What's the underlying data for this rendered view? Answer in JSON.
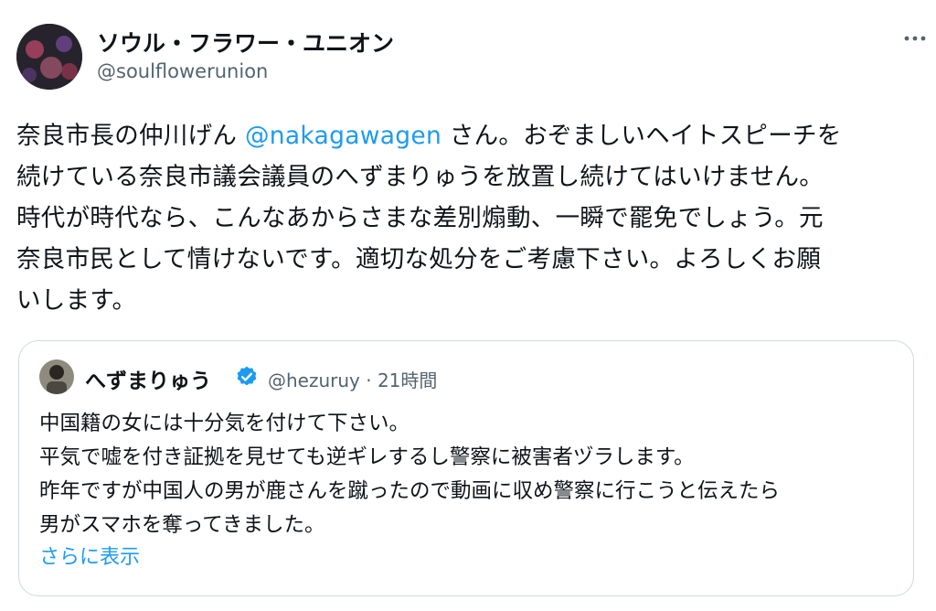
{
  "tweet": {
    "author": {
      "name": "ソウル・フラワー・ユニオン",
      "handle": "@soulflowerunion",
      "avatar_icon": "band-photo-avatar"
    },
    "more_icon": "more-options-icon",
    "body": {
      "before_mention": "奈良市長の仲川げん ",
      "mention": "@nakagawagen",
      "after_mention": " さん。おぞましいヘイトスピーチを\n続けている奈良市議会議員のへずまりゅうを放置し続けてはいけません。\n時代が時代なら、こんなあからさまな差別煽動、一瞬で罷免でしょう。元\n奈良市民として情けないです。適切な処分をご考慮下さい。よろしくお願\nいします。"
    }
  },
  "quoted": {
    "author": {
      "name": "へずまりゅう",
      "verified_icon": "verified-badge-icon",
      "handle_time": "@hezuruy · 21時間"
    },
    "text": "中国籍の女には十分気を付けて下さい。\n平気で嘘を付き証拠を見せても逆ギレするし警察に被害者ヅラします。\n昨年ですが中国人の男が鹿さんを蹴ったので動画に収め警察に行こうと伝えたら\n男がスマホを奪ってきました。",
    "show_more": "さらに表示"
  },
  "colors": {
    "link": "#1d9bf0",
    "secondary_text": "#536471",
    "border": "#cfd9de",
    "primary_text": "#0f1419"
  }
}
